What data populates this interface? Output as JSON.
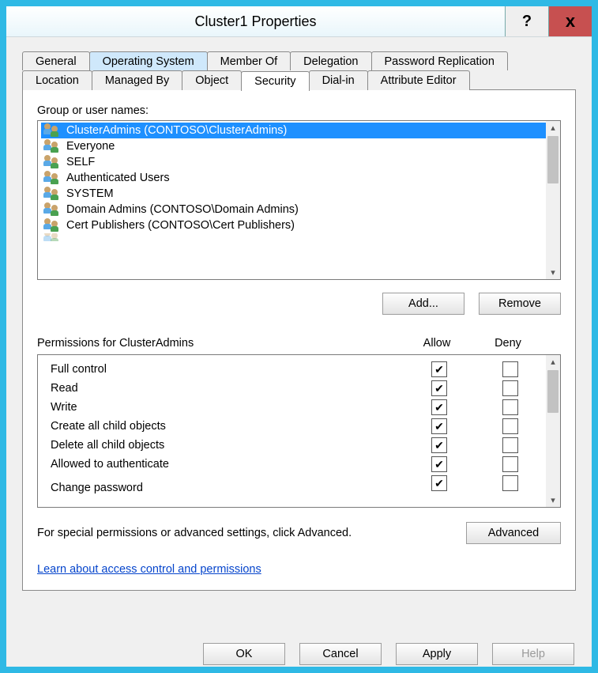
{
  "window": {
    "title": "Cluster1 Properties"
  },
  "titlebar": {
    "help": "?",
    "close": "x"
  },
  "tabs": {
    "row1": [
      {
        "label": "General",
        "state": ""
      },
      {
        "label": "Operating System",
        "state": "highlight"
      },
      {
        "label": "Member Of",
        "state": ""
      },
      {
        "label": "Delegation",
        "state": ""
      },
      {
        "label": "Password Replication",
        "state": ""
      }
    ],
    "row2": [
      {
        "label": "Location",
        "state": ""
      },
      {
        "label": "Managed By",
        "state": ""
      },
      {
        "label": "Object",
        "state": ""
      },
      {
        "label": "Security",
        "state": "active"
      },
      {
        "label": "Dial-in",
        "state": ""
      },
      {
        "label": "Attribute Editor",
        "state": ""
      }
    ]
  },
  "groups": {
    "label": "Group or user names:",
    "items": [
      {
        "text": "ClusterAdmins (CONTOSO\\ClusterAdmins)",
        "selected": true
      },
      {
        "text": "Everyone"
      },
      {
        "text": "SELF"
      },
      {
        "text": "Authenticated Users"
      },
      {
        "text": "SYSTEM"
      },
      {
        "text": "Domain Admins (CONTOSO\\Domain Admins)"
      },
      {
        "text": "Cert Publishers (CONTOSO\\Cert Publishers)"
      }
    ],
    "add": "Add...",
    "remove": "Remove"
  },
  "perms": {
    "label": "Permissions for ClusterAdmins",
    "col_allow": "Allow",
    "col_deny": "Deny",
    "rows": [
      {
        "name": "Full control",
        "allow": true,
        "deny": false
      },
      {
        "name": "Read",
        "allow": true,
        "deny": false
      },
      {
        "name": "Write",
        "allow": true,
        "deny": false
      },
      {
        "name": "Create all child objects",
        "allow": true,
        "deny": false
      },
      {
        "name": "Delete all child objects",
        "allow": true,
        "deny": false
      },
      {
        "name": "Allowed to authenticate",
        "allow": true,
        "deny": false
      },
      {
        "name": "Change password",
        "allow": true,
        "deny": false
      }
    ]
  },
  "advanced": {
    "message": "For special permissions or advanced settings, click Advanced.",
    "button": "Advanced"
  },
  "help_link": "Learn about access control and permissions",
  "buttons": {
    "ok": "OK",
    "cancel": "Cancel",
    "apply": "Apply",
    "help": "Help"
  }
}
